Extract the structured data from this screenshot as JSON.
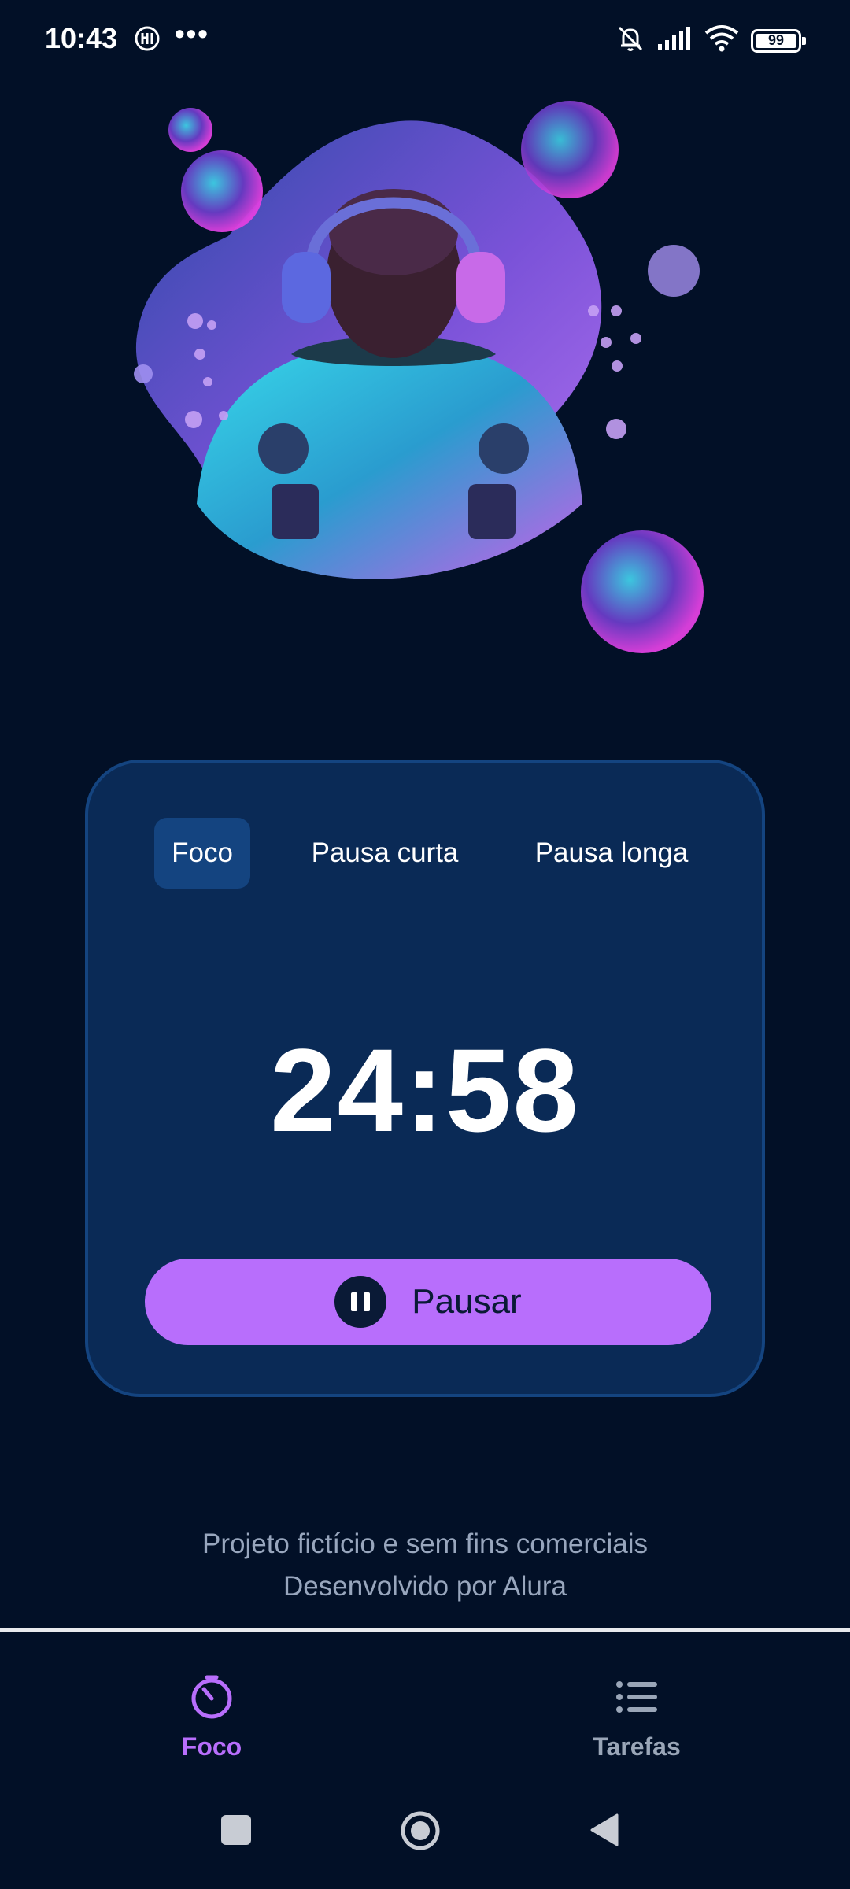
{
  "status_bar": {
    "time": "10:43",
    "dots": "•••",
    "battery": "99",
    "icons": [
      "notification-icon",
      "mute-bell-icon",
      "signal-icon",
      "wifi-icon",
      "battery-icon"
    ]
  },
  "timer_card": {
    "tabs": [
      {
        "label": "Foco",
        "active": true
      },
      {
        "label": "Pausa curta",
        "active": false
      },
      {
        "label": "Pausa longa",
        "active": false
      }
    ],
    "timer": "24:58",
    "pause_button": {
      "label": "Pausar",
      "icon": "pause-icon"
    }
  },
  "footer": {
    "line1": "Projeto fictício e sem fins comerciais",
    "line2": "Desenvolvido por Alura"
  },
  "bottom_nav": {
    "items": [
      {
        "label": "Foco",
        "icon": "timer-icon",
        "active": true
      },
      {
        "label": "Tarefas",
        "icon": "list-icon",
        "active": false
      }
    ]
  },
  "system_nav": {
    "icons": [
      "recents-icon",
      "home-icon",
      "back-icon"
    ]
  },
  "colors": {
    "background": "#021027",
    "card": "#0a2a56",
    "card_border": "#144480",
    "accent": "#b86efc",
    "muted_text": "#98a6bd"
  }
}
